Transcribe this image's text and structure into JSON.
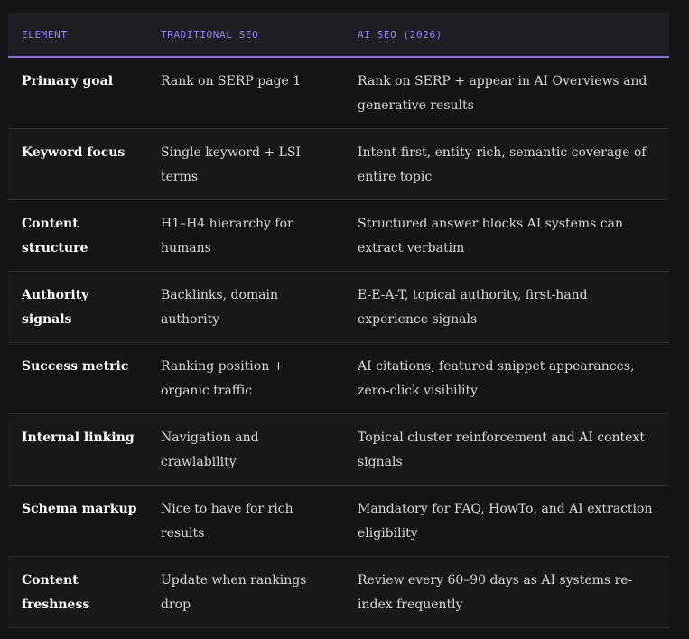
{
  "table": {
    "headers": [
      "ELEMENT",
      "TRADITIONAL SEO",
      "AI SEO (2026)"
    ],
    "rows": [
      [
        "Primary goal",
        "Rank on SERP page 1",
        "Rank on SERP + appear in AI Overviews and generative results"
      ],
      [
        "Keyword focus",
        "Single keyword + LSI terms",
        "Intent-first, entity-rich, semantic coverage of entire topic"
      ],
      [
        "Content structure",
        "H1–H4 hierarchy for humans",
        "Structured answer blocks AI systems can extract verbatim"
      ],
      [
        "Authority signals",
        "Backlinks, domain authority",
        "E-E-A-T, topical authority, first-hand experience signals"
      ],
      [
        "Success metric",
        "Ranking position + organic traffic",
        "AI citations, featured snippet appearances, zero-click visibility"
      ],
      [
        "Internal linking",
        "Navigation and crawlability",
        "Topical cluster reinforcement and AI context signals"
      ],
      [
        "Schema markup",
        "Nice to have for rich results",
        "Mandatory for FAQ, HowTo, and AI extraction eligibility"
      ],
      [
        "Content freshness",
        "Update when rankings drop",
        "Review every 60–90 days as AI systems re-index frequently"
      ]
    ]
  }
}
